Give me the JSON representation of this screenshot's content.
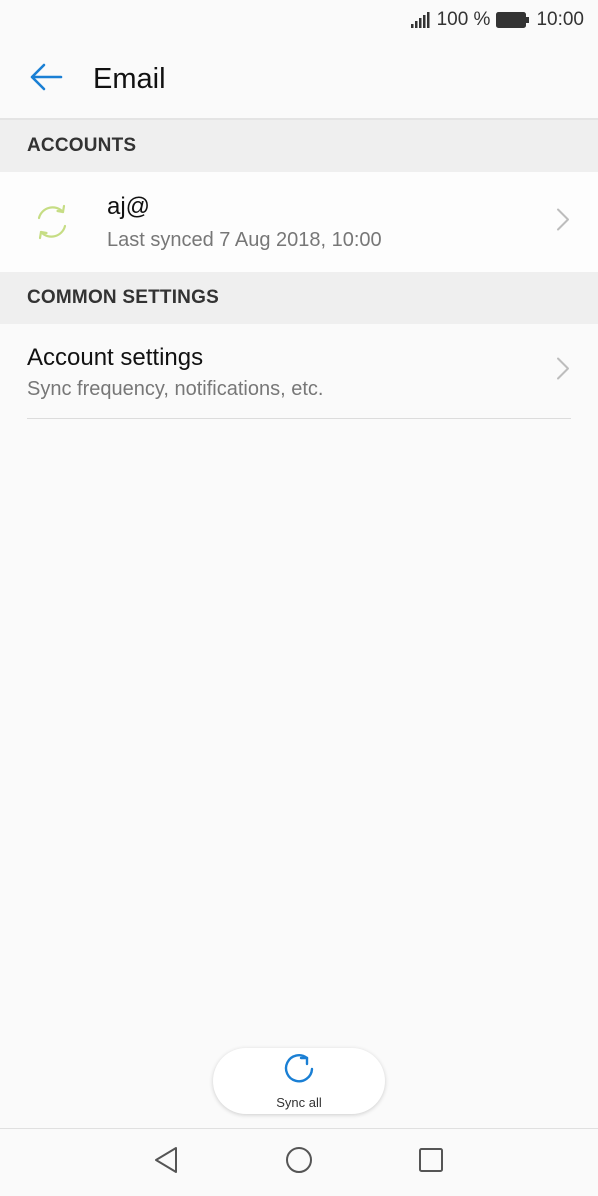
{
  "status_bar": {
    "battery_percent": "100 %",
    "time": "10:00",
    "signal_icon": "signal-icon",
    "battery_icon": "battery-icon"
  },
  "app_bar": {
    "title": "Email",
    "back_icon": "arrow-left-icon"
  },
  "accounts_section": {
    "header": "ACCOUNTS",
    "account": {
      "name": "aj@",
      "last_synced": "Last synced 7 Aug 2018, 10:00",
      "icon": "sync-icon"
    }
  },
  "common_settings_section": {
    "header": "COMMON SETTINGS",
    "item": {
      "title": "Account settings",
      "subtitle": "Sync frequency, notifications, etc."
    }
  },
  "sync_all": {
    "label": "Sync all",
    "icon": "refresh-icon"
  },
  "navigation": {
    "back_icon": "triangle-back-icon",
    "home_icon": "circle-home-icon",
    "recent_icon": "square-recents-icon"
  },
  "colors": {
    "accent": "#1a7fd4",
    "sync_icon": "#c6dd84",
    "background": "#fafafa",
    "section_background": "#efefef"
  }
}
